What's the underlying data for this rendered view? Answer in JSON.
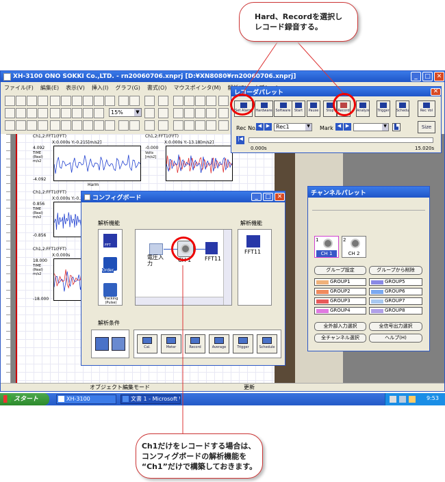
{
  "callout_top": {
    "line1": "Hard、Recordを選択し",
    "line2": "レコード録音する。"
  },
  "callout_bottom": {
    "line1": "Ch1だけをレコードする場合は、",
    "line2": "コンフィグボードの解析機能を",
    "line3": "“Ch1”だけで構築しておきます。"
  },
  "app": {
    "title": "XH-3100 ONO SOKKI Co.,LTD. - rn20060706.xnprj [D:¥XN8080¥rn20060706.xnprj]",
    "menu": [
      "ファイル(F)",
      "編集(E)",
      "表示(V)",
      "挿入(I)",
      "グラフ(G)",
      "書式(O)",
      "マウスポインタ(M)",
      "解析(S)",
      "オプション"
    ],
    "dropdown_value": "15%",
    "status_left": "オブジェクト編集モード",
    "status_right": "更新"
  },
  "graphs": [
    {
      "title": "Ch1,2:FFT1(FFT)",
      "xlabel": "X:0.000s",
      "yinfo": "Y:-0.215[m/s2]",
      "ytop": "4.092",
      "ybot": "-4.092",
      "yunit": "TIME (Real) m/s2",
      "xaxis": "Harm"
    },
    {
      "title": "Ch1,2:FFT1(FFT)",
      "xlabel": "X:0.000s",
      "yinfo": "Y:-0.215[m/s2]",
      "ytop": "0.856",
      "ybot": "-0.856",
      "yunit": "TIME (Real) m/s2",
      "xaxis": ""
    },
    {
      "title": "Ch1,2:FFT1(FFT)",
      "xlabel": "X:0.000s",
      "yinfo": "",
      "ytop": "18.000",
      "ybot": "-18.000",
      "yunit": "TIME (Real) m/s2",
      "xaxis": "s"
    },
    {
      "title": "Ch1,2:FFT1(FFT)",
      "xlabel": "X:0.000s",
      "yinfo": "Y:-13.18[m/s2]",
      "ytop": "-0.000",
      "ybot": "",
      "yunit": "Volts [m/s2]",
      "xaxis": ""
    }
  ],
  "rec_palette": {
    "title": "レコーダパレット",
    "buttons": [
      "Set Alarm",
      "Hardware",
      "Software",
      "Start",
      "Pause",
      "Stop",
      "Record",
      "Analyze",
      "Trigger",
      "Schedule",
      "Rec Vol"
    ],
    "rec_no_label": "Rec No.",
    "rec_value": "Rec1",
    "mark_label": "Mark",
    "time_start": "0.000s",
    "time_end": "15.020s",
    "size_label": "Size"
  },
  "config_board": {
    "title": "コンフィグボード",
    "analysis_label": "解析機能",
    "analysis_label_right": "解析機能",
    "items_left": [
      "FFT",
      "Order",
      "Tracking (Pulse)"
    ],
    "node_input": "電圧入力",
    "node_ch": "CH 1",
    "node_fft": "FFT11",
    "right_item": "FFT11",
    "conditions_label": "解析条件",
    "cond_buttons": [
      "Cal.",
      "Meter",
      "Record",
      "Average",
      "Trigger",
      "Schedule"
    ]
  },
  "channel_palette": {
    "title": "チャンネルパレット",
    "ch1": "CH 1",
    "ch2": "CH 2",
    "num1": "1",
    "num2": "2",
    "btn_group_set": "グループ設定",
    "btn_group_del": "グループから削除",
    "groups_left": [
      {
        "name": "GROUP1",
        "color": "#f0b27a"
      },
      {
        "name": "GROUP2",
        "color": "#f08a5c"
      },
      {
        "name": "GROUP3",
        "color": "#e85a5a"
      },
      {
        "name": "GROUP4",
        "color": "#e07ae0"
      }
    ],
    "groups_right": [
      {
        "name": "GROUP5",
        "color": "#8a8ae6"
      },
      {
        "name": "GROUP6",
        "color": "#7aa8f0"
      },
      {
        "name": "GROUP7",
        "color": "#a8c8f0"
      },
      {
        "name": "GROUP8",
        "color": "#b0a0e8"
      }
    ],
    "btn_all_ext": "全外部入力選択",
    "btn_all_sig": "全信号出力選択",
    "btn_all_ch": "全チャンネル選択",
    "btn_help": "ヘルプ(H)"
  },
  "taskbar": {
    "start": "スタート",
    "items": [
      "XH-3100",
      "文書 1 - Microsoft W..."
    ],
    "clock": "9:53"
  }
}
